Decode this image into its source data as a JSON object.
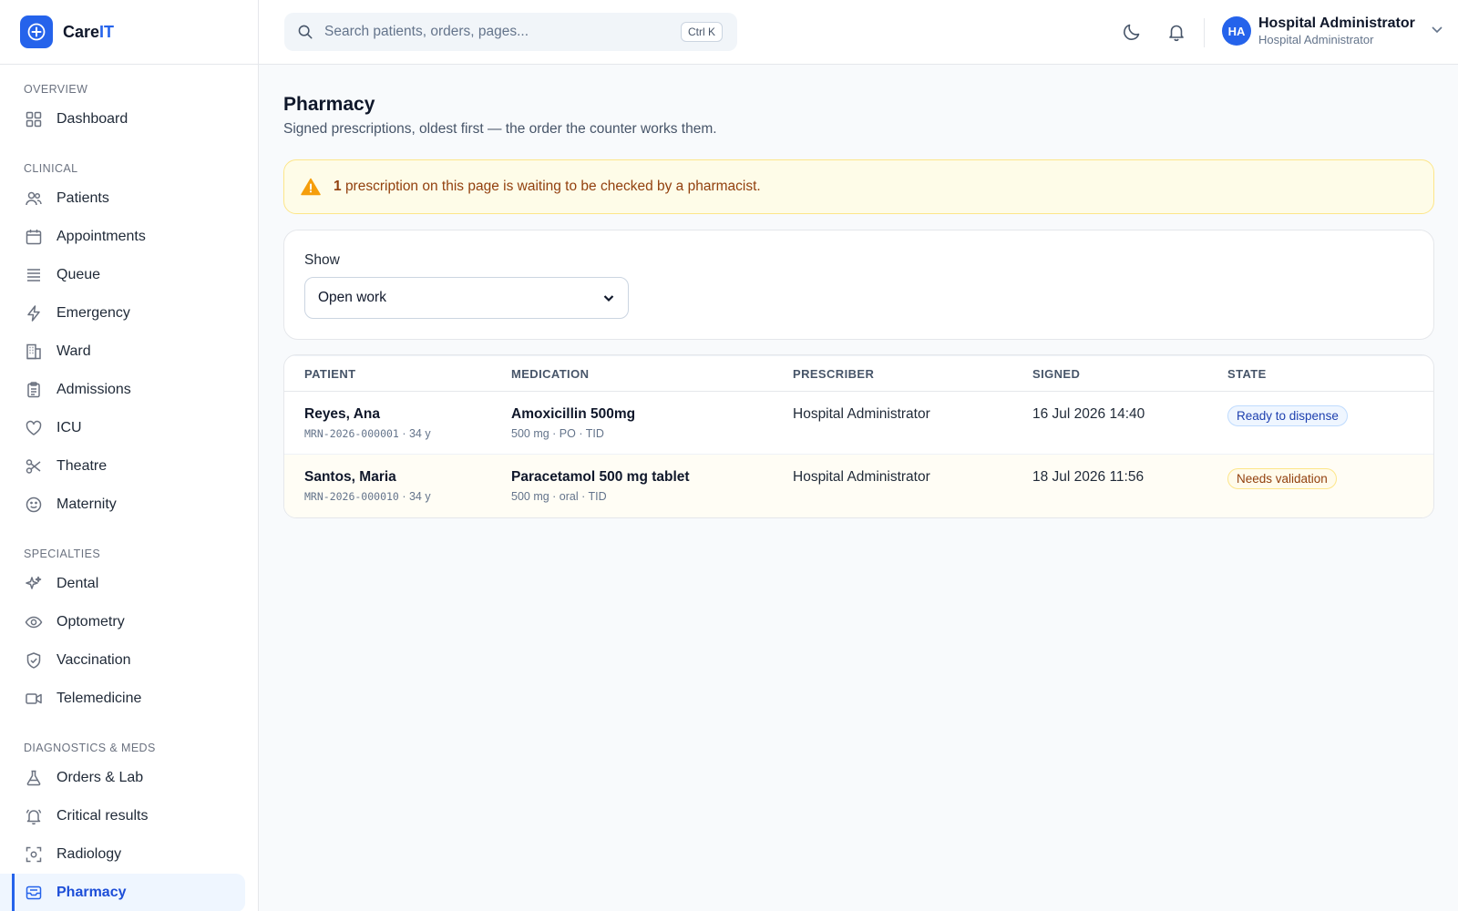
{
  "brand": {
    "name_prefix": "Care",
    "name_suffix": "IT"
  },
  "sidebar": {
    "sections": {
      "overview": "OVERVIEW",
      "clinical": "CLINICAL",
      "specialties": "SPECIALTIES",
      "diagnostics": "DIAGNOSTICS & MEDS"
    },
    "items": {
      "dashboard": "Dashboard",
      "patients": "Patients",
      "appointments": "Appointments",
      "queue": "Queue",
      "emergency": "Emergency",
      "ward": "Ward",
      "admissions": "Admissions",
      "icu": "ICU",
      "theatre": "Theatre",
      "maternity": "Maternity",
      "dental": "Dental",
      "optometry": "Optometry",
      "vaccination": "Vaccination",
      "telemedicine": "Telemedicine",
      "orders_lab": "Orders & Lab",
      "critical_results": "Critical results",
      "radiology": "Radiology",
      "pharmacy": "Pharmacy"
    },
    "active": "pharmacy"
  },
  "header": {
    "search_placeholder": "Search patients, orders, pages...",
    "search_shortcut": "Ctrl K",
    "user": {
      "initials": "HA",
      "name": "Hospital Administrator",
      "role": "Hospital Administrator"
    }
  },
  "page": {
    "title": "Pharmacy",
    "subtitle": "Signed prescriptions, oldest first — the order the counter works them."
  },
  "alert": {
    "count": "1",
    "text": "prescription on this page is waiting to be checked by a pharmacist."
  },
  "filter": {
    "label": "Show",
    "selected": "Open work"
  },
  "table": {
    "headers": {
      "patient": "PATIENT",
      "medication": "MEDICATION",
      "prescriber": "PRESCRIBER",
      "signed": "SIGNED",
      "state": "STATE"
    },
    "rows": [
      {
        "patient": "Reyes, Ana",
        "mrn": "MRN-2026-000001",
        "age": " · 34 y",
        "medication": "Amoxicillin 500mg",
        "dose": "500 mg · PO · TID",
        "prescriber": "Hospital Administrator",
        "signed": "16 Jul 2026 14:40",
        "state": "Ready to dispense"
      },
      {
        "patient": "Santos, Maria",
        "mrn": "MRN-2026-000010",
        "age": " · 34 y",
        "medication": "Paracetamol 500 mg tablet",
        "dose": "500 mg · oral · TID",
        "prescriber": "Hospital Administrator",
        "signed": "18 Jul 2026 11:56",
        "state": "Needs validation"
      }
    ]
  },
  "colors": {
    "accent": "#2563eb",
    "ready_badge": "#1e40af",
    "warning_badge": "#92400e",
    "alert_bg": "#fefce8"
  }
}
